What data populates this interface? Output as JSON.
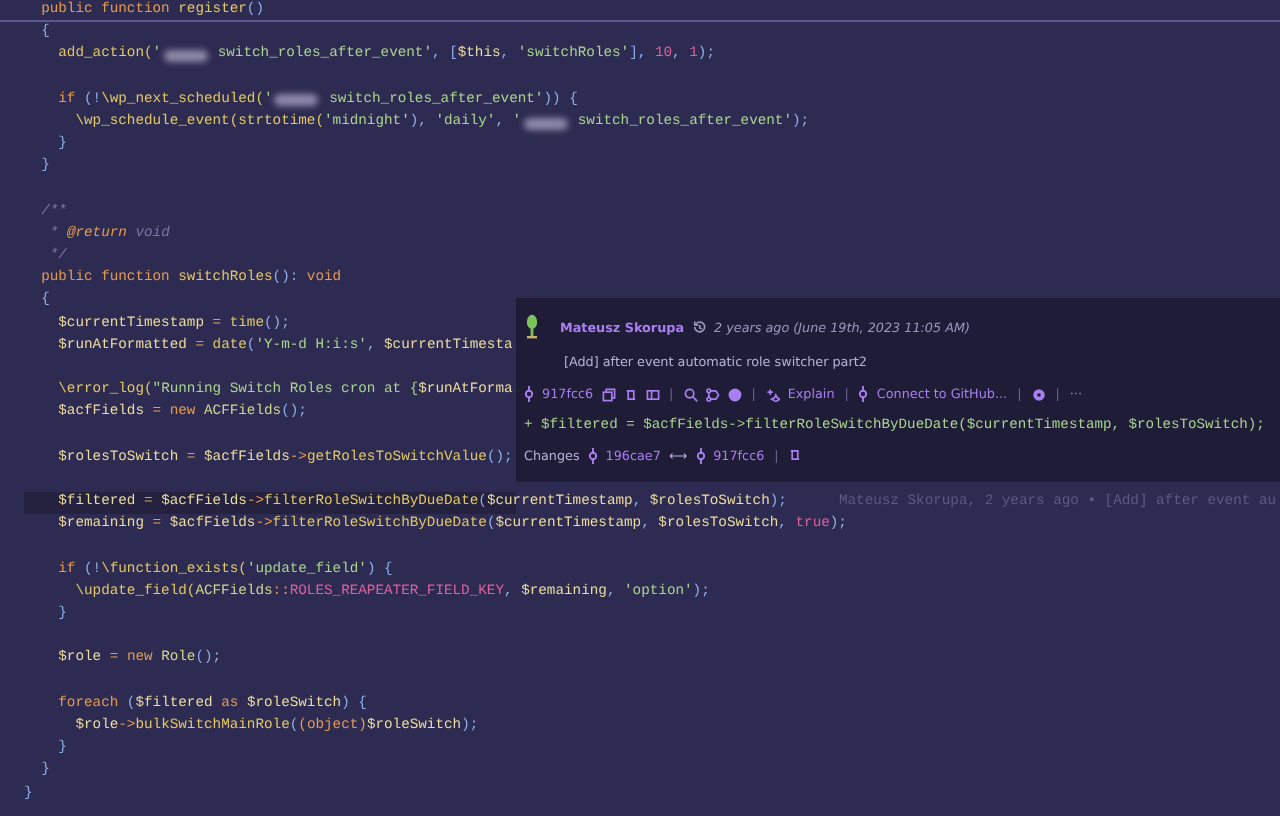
{
  "sticky_header": [
    {
      "kind": "kw",
      "text": "  public function "
    },
    {
      "kind": "fn",
      "text": "register"
    },
    {
      "kind": "punc",
      "text": "()"
    }
  ],
  "lines": [
    {
      "current": false,
      "tokens": [
        {
          "kind": "punc",
          "text": "  {"
        }
      ]
    },
    {
      "current": false,
      "tokens": [
        {
          "kind": "fn",
          "text": "    add_action("
        },
        {
          "kind": "str",
          "text": "'"
        },
        {
          "kind": "redacted"
        },
        {
          "kind": "str",
          "text": " switch_roles_after_event'"
        },
        {
          "kind": "punc",
          "text": ", ["
        },
        {
          "kind": "var",
          "text": "$this"
        },
        {
          "kind": "punc",
          "text": ", "
        },
        {
          "kind": "str",
          "text": "'switchRoles'"
        },
        {
          "kind": "punc",
          "text": "], "
        },
        {
          "kind": "num",
          "text": "10"
        },
        {
          "kind": "punc",
          "text": ", "
        },
        {
          "kind": "num",
          "text": "1"
        },
        {
          "kind": "punc",
          "text": ");"
        }
      ]
    },
    {
      "current": false
    },
    {
      "current": false,
      "tokens": [
        {
          "kind": "kw",
          "text": "    if"
        },
        {
          "kind": "punc",
          "text": " (!"
        },
        {
          "kind": "fn",
          "text": "\\wp_next_scheduled("
        },
        {
          "kind": "str",
          "text": "'"
        },
        {
          "kind": "redacted"
        },
        {
          "kind": "str",
          "text": " switch_roles_after_event'"
        },
        {
          "kind": "punc",
          "text": ")) {"
        }
      ]
    },
    {
      "current": false,
      "tokens": [
        {
          "kind": "fn",
          "text": "      \\wp_schedule_event("
        },
        {
          "kind": "fn",
          "text": "strtotime("
        },
        {
          "kind": "str",
          "text": "'midnight'"
        },
        {
          "kind": "punc",
          "text": "), "
        },
        {
          "kind": "str",
          "text": "'daily'"
        },
        {
          "kind": "punc",
          "text": ", "
        },
        {
          "kind": "str",
          "text": "'"
        },
        {
          "kind": "redacted"
        },
        {
          "kind": "str",
          "text": " switch_roles_after_event'"
        },
        {
          "kind": "punc",
          "text": ");"
        }
      ]
    },
    {
      "current": false,
      "tokens": [
        {
          "kind": "punc",
          "text": "    }"
        }
      ]
    },
    {
      "current": false,
      "tokens": [
        {
          "kind": "punc",
          "text": "  }"
        }
      ]
    },
    {
      "current": false
    },
    {
      "current": false,
      "tokens": [
        {
          "kind": "cmt",
          "text": "  /**"
        }
      ]
    },
    {
      "current": false,
      "tokens": [
        {
          "kind": "cmt",
          "text": "   * "
        },
        {
          "kind": "tag",
          "text": "@return"
        },
        {
          "kind": "cmt",
          "text": " void"
        }
      ]
    },
    {
      "current": false,
      "tokens": [
        {
          "kind": "cmt",
          "text": "   */"
        }
      ]
    },
    {
      "current": false,
      "tokens": [
        {
          "kind": "kw",
          "text": "  public function "
        },
        {
          "kind": "fn",
          "text": "switchRoles"
        },
        {
          "kind": "punc",
          "text": "(): "
        },
        {
          "kind": "kw",
          "text": "void"
        }
      ]
    },
    {
      "current": false,
      "tokens": [
        {
          "kind": "punc",
          "text": "  {"
        }
      ]
    },
    {
      "current": false,
      "tokens": [
        {
          "kind": "var",
          "text": "    $currentTimestamp"
        },
        {
          "kind": "op",
          "text": " = "
        },
        {
          "kind": "fn",
          "text": "time"
        },
        {
          "kind": "punc",
          "text": "();"
        }
      ]
    },
    {
      "current": false,
      "tokens": [
        {
          "kind": "var",
          "text": "    $runAtFormatted"
        },
        {
          "kind": "op",
          "text": " = "
        },
        {
          "kind": "fn",
          "text": "date"
        },
        {
          "kind": "punc",
          "text": "("
        },
        {
          "kind": "str",
          "text": "'Y-m-d H:i:s'"
        },
        {
          "kind": "punc",
          "text": ", "
        },
        {
          "kind": "var",
          "text": "$currentTimesta"
        }
      ]
    },
    {
      "current": false
    },
    {
      "current": false,
      "tokens": [
        {
          "kind": "fn",
          "text": "    \\error_log("
        },
        {
          "kind": "str",
          "text": "\"Running Switch Roles cron at {"
        },
        {
          "kind": "var",
          "text": "$runAtForma"
        }
      ]
    },
    {
      "current": false,
      "tokens": [
        {
          "kind": "var",
          "text": "    $acfFields"
        },
        {
          "kind": "op",
          "text": " = "
        },
        {
          "kind": "kw",
          "text": "new "
        },
        {
          "kind": "cls",
          "text": "ACFFields"
        },
        {
          "kind": "punc",
          "text": "();"
        }
      ]
    },
    {
      "current": false
    },
    {
      "current": false,
      "tokens": [
        {
          "kind": "var",
          "text": "    $rolesToSwitch"
        },
        {
          "kind": "op",
          "text": " = "
        },
        {
          "kind": "var",
          "text": "$acfFields"
        },
        {
          "kind": "op",
          "text": "->"
        },
        {
          "kind": "fn",
          "text": "getRolesToSwitchValue"
        },
        {
          "kind": "punc",
          "text": "();"
        }
      ]
    },
    {
      "current": false
    },
    {
      "current": true,
      "blame": "Mateusz Skorupa, 2 years ago • [Add] after event au",
      "tokens": [
        {
          "kind": "var",
          "text": "    $filtered"
        },
        {
          "kind": "op",
          "text": " = "
        },
        {
          "kind": "var",
          "text": "$acfFields"
        },
        {
          "kind": "op",
          "text": "->"
        },
        {
          "kind": "fn",
          "text": "filterRoleSwitchByDueDate"
        },
        {
          "kind": "punc",
          "text": "("
        },
        {
          "kind": "var",
          "text": "$currentTimestamp"
        },
        {
          "kind": "punc",
          "text": ", "
        },
        {
          "kind": "var",
          "text": "$rolesToSwitch"
        },
        {
          "kind": "punc",
          "text": ");"
        }
      ]
    },
    {
      "current": false,
      "tokens": [
        {
          "kind": "var",
          "text": "    $remaining"
        },
        {
          "kind": "op",
          "text": " = "
        },
        {
          "kind": "var",
          "text": "$acfFields"
        },
        {
          "kind": "op",
          "text": "->"
        },
        {
          "kind": "fn",
          "text": "filterRoleSwitchByDueDate"
        },
        {
          "kind": "punc",
          "text": "("
        },
        {
          "kind": "var",
          "text": "$currentTimestamp"
        },
        {
          "kind": "punc",
          "text": ", "
        },
        {
          "kind": "var",
          "text": "$rolesToSwitch"
        },
        {
          "kind": "punc",
          "text": ", "
        },
        {
          "kind": "num",
          "text": "true"
        },
        {
          "kind": "punc",
          "text": ");"
        }
      ]
    },
    {
      "current": false
    },
    {
      "current": false,
      "tokens": [
        {
          "kind": "kw",
          "text": "    if"
        },
        {
          "kind": "punc",
          "text": " (!"
        },
        {
          "kind": "fn",
          "text": "\\function_exists("
        },
        {
          "kind": "str",
          "text": "'update_field'"
        },
        {
          "kind": "punc",
          "text": ") {"
        }
      ]
    },
    {
      "current": false,
      "tokens": [
        {
          "kind": "fn",
          "text": "      \\update_field("
        },
        {
          "kind": "cls",
          "text": "ACFFields"
        },
        {
          "kind": "op",
          "text": "::"
        },
        {
          "kind": "const",
          "text": "ROLES_REAPEATER_FIELD_KEY"
        },
        {
          "kind": "punc",
          "text": ", "
        },
        {
          "kind": "var",
          "text": "$remaining"
        },
        {
          "kind": "punc",
          "text": ", "
        },
        {
          "kind": "str",
          "text": "'option'"
        },
        {
          "kind": "punc",
          "text": ");"
        }
      ]
    },
    {
      "current": false,
      "tokens": [
        {
          "kind": "punc",
          "text": "    }"
        }
      ]
    },
    {
      "current": false
    },
    {
      "current": false,
      "tokens": [
        {
          "kind": "var",
          "text": "    $role"
        },
        {
          "kind": "op",
          "text": " = "
        },
        {
          "kind": "kw",
          "text": "new "
        },
        {
          "kind": "cls",
          "text": "Role"
        },
        {
          "kind": "punc",
          "text": "();"
        }
      ]
    },
    {
      "current": false
    },
    {
      "current": false,
      "tokens": [
        {
          "kind": "kw",
          "text": "    foreach"
        },
        {
          "kind": "punc",
          "text": " ("
        },
        {
          "kind": "var",
          "text": "$filtered"
        },
        {
          "kind": "kw",
          "text": " as "
        },
        {
          "kind": "var",
          "text": "$roleSwitch"
        },
        {
          "kind": "punc",
          "text": ") {"
        }
      ]
    },
    {
      "current": false,
      "tokens": [
        {
          "kind": "var",
          "text": "      $role"
        },
        {
          "kind": "op",
          "text": "->"
        },
        {
          "kind": "fn",
          "text": "bulkSwitchMainRole"
        },
        {
          "kind": "punc",
          "text": "("
        },
        {
          "kind": "kw",
          "text": "(object)"
        },
        {
          "kind": "var",
          "text": "$roleSwitch"
        },
        {
          "kind": "punc",
          "text": ");"
        }
      ]
    },
    {
      "current": false,
      "tokens": [
        {
          "kind": "punc",
          "text": "    }"
        }
      ]
    },
    {
      "current": false,
      "tokens": [
        {
          "kind": "punc",
          "text": "  }"
        }
      ]
    },
    {
      "current": false,
      "tokens": [
        {
          "kind": "punc",
          "text": "}"
        }
      ]
    }
  ],
  "blame_popup": {
    "author": "Mateusz Skorupa",
    "time": "2 years ago (June 19th, 2023 11:05 AM)",
    "message": "[Add] after event automatic role switcher part2",
    "commit": "917fcc6",
    "explain": "Explain",
    "connect": "Connect to GitHub...",
    "more": "···",
    "diff_line": "+ $filtered = $acfFields->filterRoleSwitchByDueDate($currentTimestamp, $rolesToSwitch);",
    "toolbar_separators": [
      "|",
      "|",
      "|",
      "|",
      "|"
    ],
    "changes_separator": "|",
    "changes_label": "Changes",
    "from_commit": "196cae7",
    "arrow": "⟷",
    "to_commit": "917fcc6"
  }
}
